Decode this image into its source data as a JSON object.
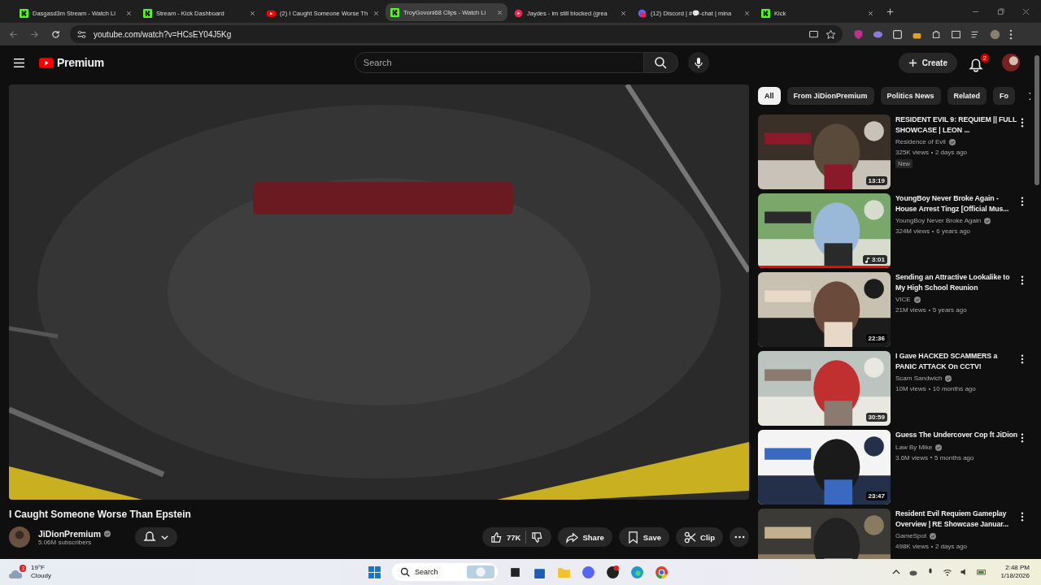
{
  "browser": {
    "tabs": [
      {
        "title": "Dasgasd3m Stream - Watch Li",
        "kind": "kick",
        "selected": false
      },
      {
        "title": "Stream - Kick Dashboard",
        "kind": "kick",
        "selected": false
      },
      {
        "title": "(2) I Caught Someone Worse Th",
        "kind": "youtube",
        "selected": false
      },
      {
        "title": "TroyGovoni68 Clips - Watch Li",
        "kind": "kick",
        "selected": true
      },
      {
        "title": "Jaydes - im still blocked (grea",
        "kind": "music",
        "selected": false
      },
      {
        "title": "(12) Discord | #💬-chat | mina",
        "kind": "discord",
        "selected": false
      },
      {
        "title": "Kick",
        "kind": "kick",
        "selected": false
      }
    ],
    "address": "youtube.com/watch?v=HCsEY04J5Kg"
  },
  "header": {
    "logo": "Premium",
    "search": {
      "placeholder": "Search"
    },
    "create": "Create",
    "notifications": "2"
  },
  "video": {
    "title": "I Caught Someone Worse Than Epstein",
    "channel": "JiDionPremium",
    "subscribers": "5.06M subscribers",
    "likes": "77K",
    "actions": [
      "Share",
      "Save",
      "Clip"
    ]
  },
  "chips": [
    {
      "label": "All",
      "selected": true
    },
    {
      "label": "From JiDionPremium",
      "selected": false
    },
    {
      "label": "Politics News",
      "selected": false
    },
    {
      "label": "Related",
      "selected": false
    },
    {
      "label": "Fo",
      "selected": false
    }
  ],
  "recommended": [
    {
      "title": "RESIDENT EVIL 9: REQUIEM || FULL SHOWCASE | LEON ...",
      "channel": "Residence of Evil",
      "views": "325K views",
      "age": "2 days ago",
      "badge": "New",
      "duration": "13:19"
    },
    {
      "title": "YoungBoy Never Broke Again - House Arrest Tingz [Official Mus...",
      "channel": "YoungBoy Never Broke Again",
      "views": "324M views",
      "age": "6 years ago",
      "duration": "3:01",
      "music": true,
      "level": 1
    },
    {
      "title": "Sending an Attractive Lookalike to My High School Reunion",
      "channel": "VICE",
      "views": "21M views",
      "age": "5 years ago",
      "duration": "22:36"
    },
    {
      "title": "I Gave HACKED SCAMMERS a PANIC ATTACK On CCTV!",
      "channel": "Scam Sandwich",
      "views": "10M views",
      "age": "10 months ago",
      "duration": "30:59"
    },
    {
      "title": "Guess The Undercover Cop ft JiDion",
      "channel": "Law By Mike",
      "views": "3.6M views",
      "age": "5 months ago",
      "duration": "23:47"
    },
    {
      "title": "Resident Evil Requiem Gameplay Overview | RE Showcase Januar...",
      "channel": "GameSpot",
      "views": "498K views",
      "age": "2 days ago"
    }
  ],
  "taskbar": {
    "temperature": "19°F",
    "weather": "Cloudy",
    "weather_badge": "3",
    "search": "Search",
    "time": "2:48 PM",
    "date": "1/18/2026"
  }
}
